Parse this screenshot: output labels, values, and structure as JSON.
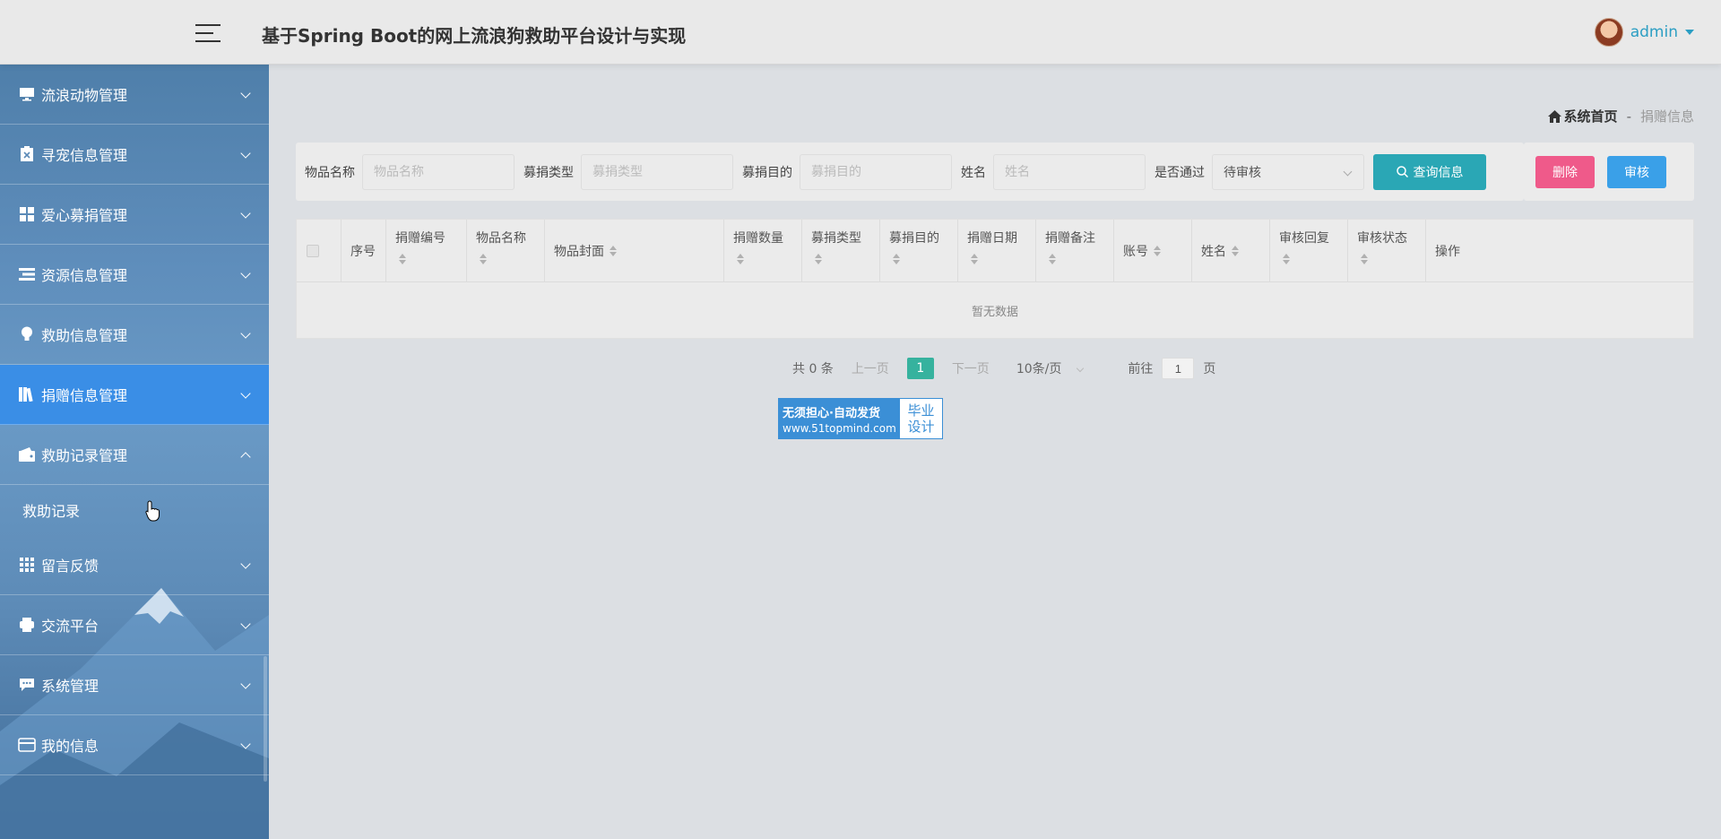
{
  "header": {
    "title": "基于Spring Boot的网上流浪狗救助平台设计与实现",
    "user_name": "admin"
  },
  "sidebar": {
    "items": [
      {
        "label": "流浪动物管理",
        "icon": "monitor-icon",
        "expanded": false
      },
      {
        "label": "寻宠信息管理",
        "icon": "clipboard-x-icon",
        "expanded": false
      },
      {
        "label": "爱心募捐管理",
        "icon": "grid-icon",
        "expanded": false
      },
      {
        "label": "资源信息管理",
        "icon": "list-icon",
        "expanded": false
      },
      {
        "label": "救助信息管理",
        "icon": "lightbulb-icon",
        "expanded": false
      },
      {
        "label": "捐赠信息管理",
        "icon": "books-icon",
        "expanded": false,
        "active": true
      },
      {
        "label": "救助记录管理",
        "icon": "wallet-icon",
        "expanded": true
      }
    ],
    "submenu": {
      "label": "救助记录"
    },
    "items_after": [
      {
        "label": "留言反馈",
        "icon": "apps-icon"
      },
      {
        "label": "交流平台",
        "icon": "printer-icon"
      },
      {
        "label": "系统管理",
        "icon": "chat-icon"
      },
      {
        "label": "我的信息",
        "icon": "card-icon"
      }
    ]
  },
  "breadcrumb": {
    "home": "系统首页",
    "separator": "-",
    "current": "捐赠信息"
  },
  "search": {
    "fields": [
      {
        "label": "物品名称",
        "placeholder": "物品名称"
      },
      {
        "label": "募捐类型",
        "placeholder": "募捐类型"
      },
      {
        "label": "募捐目的",
        "placeholder": "募捐目的"
      },
      {
        "label": "姓名",
        "placeholder": "姓名"
      }
    ],
    "approve_label": "是否通过",
    "approve_value": "待审核",
    "search_button": "查询信息"
  },
  "actions": {
    "delete": "删除",
    "audit": "审核"
  },
  "table": {
    "columns": [
      "序号",
      "捐赠编号",
      "物品名称",
      "物品封面",
      "捐赠数量",
      "募捐类型",
      "募捐目的",
      "捐赠日期",
      "捐赠备注",
      "账号",
      "姓名",
      "审核回复",
      "审核状态",
      "操作"
    ],
    "empty_text": "暂无数据"
  },
  "pagination": {
    "total": "共 0 条",
    "prev": "上一页",
    "current_page": "1",
    "next": "下一页",
    "page_size": "10条/页",
    "goto_label": "前往",
    "goto_value": "1",
    "goto_suffix": "页"
  },
  "ad": {
    "line1": "无须担心·自动发货",
    "line2": "www.51topmind.com",
    "right_line1": "毕业",
    "right_line2": "设计"
  },
  "colors": {
    "accent_teal": "#2aa7b5",
    "active_menu": "#3a8ee6",
    "delete": "#ef5a8a",
    "audit": "#3aa0e8",
    "page_active": "#36b29e"
  }
}
